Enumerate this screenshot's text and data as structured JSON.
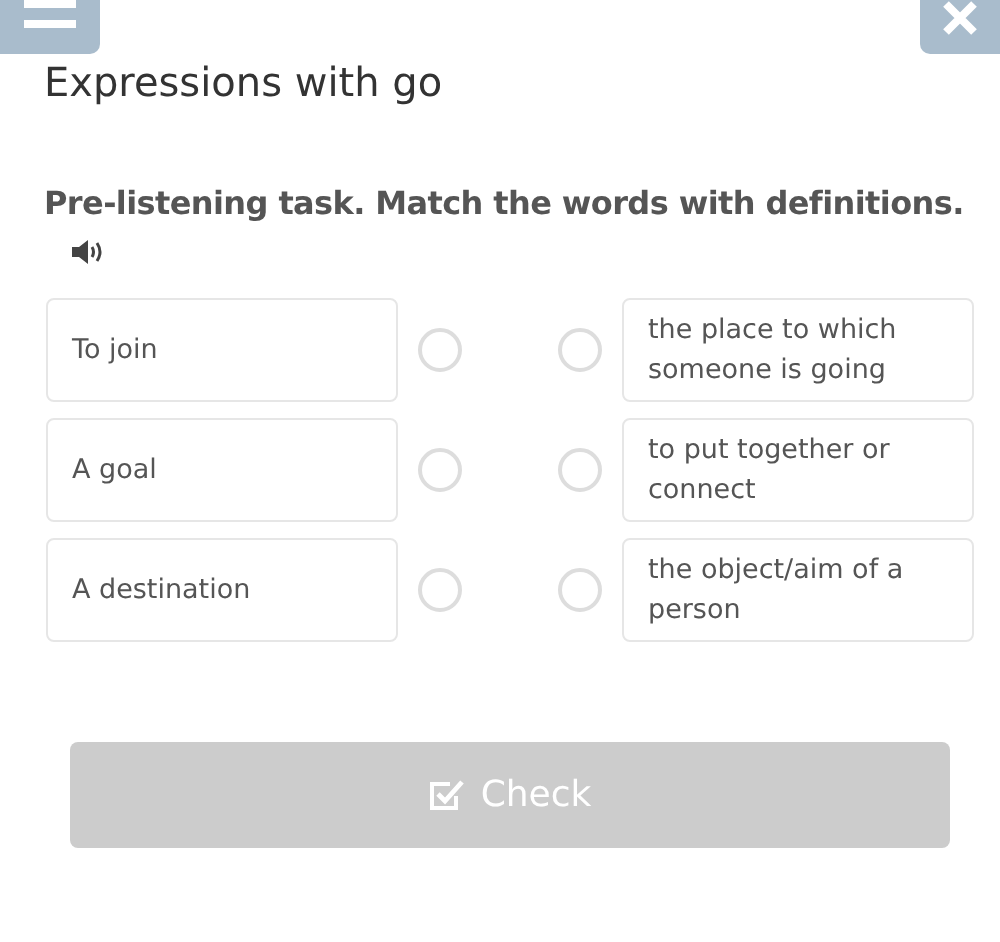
{
  "title": "Expressions with go",
  "instruction": "Pre-listening task. Match the words with definitions.",
  "words": [
    {
      "text": "To join",
      "selected": false
    },
    {
      "text": "A goal",
      "selected": false
    },
    {
      "text": "A destination",
      "selected": false
    }
  ],
  "definitions": [
    {
      "text": "the place to which someone is going",
      "selected": false
    },
    {
      "text": "to put together or connect",
      "selected": false
    },
    {
      "text": "the object/aim of a person",
      "selected": false
    }
  ],
  "check_button": {
    "label": "Check",
    "disabled": true
  }
}
